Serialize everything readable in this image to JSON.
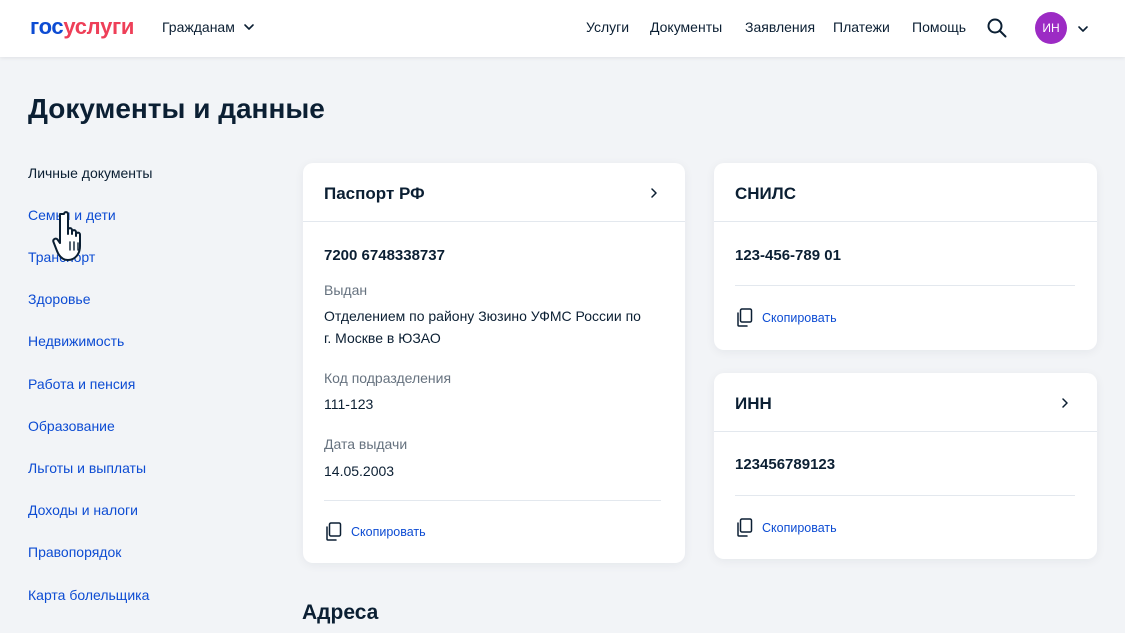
{
  "header": {
    "logo_part1": "гос",
    "logo_part2": "услуги",
    "audience_label": "Гражданам",
    "nav": [
      "Услуги",
      "Документы",
      "Заявления",
      "Платежи",
      "Помощь"
    ],
    "avatar_initials": "ИН",
    "colors": {
      "brand_blue": "#0d4cd3",
      "brand_red": "#ee3f58",
      "avatar": "#9c2bc4"
    }
  },
  "page": {
    "title": "Документы и данные"
  },
  "sidebar": {
    "items": [
      "Личные документы",
      "Семья и дети",
      "Транспорт",
      "Здоровье",
      "Недвижимость",
      "Работа и пенсия",
      "Образование",
      "Льготы и выплаты",
      "Доходы и налоги",
      "Правопорядок",
      "Карта болельщика"
    ],
    "active_index": 0
  },
  "passport": {
    "title": "Паспорт РФ",
    "number": "7200 6748338737",
    "issued_label": "Выдан",
    "issued_line1": "Отделением по району Зюзино УФМС России по",
    "issued_line2": "г. Москве в ЮЗАО",
    "code_label": "Код подразделения",
    "code_value": "111-123",
    "date_label": "Дата выдачи",
    "date_value": "14.05.2003",
    "copy_label": "Скопировать"
  },
  "snils": {
    "title": "СНИЛС",
    "number": "123-456-789 01",
    "copy_label": "Скопировать"
  },
  "inn": {
    "title": "ИНН",
    "number": "123456789123",
    "copy_label": "Скопировать"
  },
  "addresses": {
    "title": "Адреса"
  }
}
